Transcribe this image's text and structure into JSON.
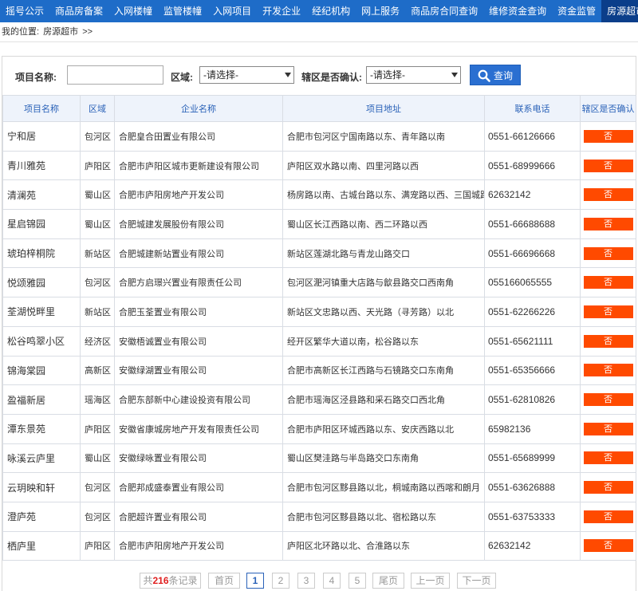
{
  "nav": {
    "items": [
      "摇号公示",
      "商品房备案",
      "入网楼幢",
      "监管楼幢",
      "入网项目",
      "开发企业",
      "经纪机构",
      "网上服务",
      "商品房合同查询",
      "维修资金查询",
      "资金监管",
      "房源超市"
    ],
    "active": "房源超市",
    "colors": {
      "bar": "#1e6cc8",
      "active": "#0b3e8a"
    }
  },
  "breadcrumb": {
    "label": "我的位置:",
    "current": "房源超市",
    "arrows": ">>"
  },
  "search": {
    "project_label": "项目名称:",
    "project_value": "",
    "district_label": "区域:",
    "district_value": "-请选择-",
    "confirm_label": "辖区是否确认:",
    "confirm_value": "-请选择-",
    "button_label": "查询",
    "icon": "search-icon"
  },
  "table": {
    "headers": [
      "项目名称",
      "区域",
      "企业名称",
      "项目地址",
      "联系电话",
      "辖区是否确认"
    ],
    "badge_color": "#ff4a00",
    "rows": [
      {
        "name": "宁和居",
        "district": "包河区",
        "company": "合肥皇合田置业有限公司",
        "address": "合肥市包河区宁国南路以东、青年路以南",
        "phone": "0551-66126666",
        "confirmed": "否"
      },
      {
        "name": "青川雅苑",
        "district": "庐阳区",
        "company": "合肥市庐阳区城市更新建设有限公司",
        "address": "庐阳区双水路以南、四里河路以西",
        "phone": "0551-68999666",
        "confirmed": "否"
      },
      {
        "name": "清澜苑",
        "district": "蜀山区",
        "company": "合肥市庐阳房地产开发公司",
        "address": "杨房路以南、古城台路以东、满宠路以西、三国城路以北",
        "phone": "62632142",
        "confirmed": "否"
      },
      {
        "name": "星启锦园",
        "district": "蜀山区",
        "company": "合肥城建发展股份有限公司",
        "address": "蜀山区长江西路以南、西二环路以西",
        "phone": "0551-66688688",
        "confirmed": "否"
      },
      {
        "name": "琥珀梓桐院",
        "district": "新站区",
        "company": "合肥城建新站置业有限公司",
        "address": "新站区莲湖北路与青龙山路交口",
        "phone": "0551-66696668",
        "confirmed": "否"
      },
      {
        "name": "悦颂雅园",
        "district": "包河区",
        "company": "合肥方启璟兴置业有限责任公司",
        "address": "包河区淝河镇重大店路与歙县路交口西南角",
        "phone": "055166065555",
        "confirmed": "否"
      },
      {
        "name": "荃湖悦畔里",
        "district": "新站区",
        "company": "合肥玉荃置业有限公司",
        "address": "新站区文忠路以西、天光路（寻芳路）以北",
        "phone": "0551-62266226",
        "confirmed": "否"
      },
      {
        "name": "松谷鸣翠小区",
        "district": "经济区",
        "company": "安徽梧诚置业有限公司",
        "address": "经开区繁华大道以南，松谷路以东",
        "phone": "0551-65621111",
        "confirmed": "否"
      },
      {
        "name": "锦海棠园",
        "district": "高新区",
        "company": "安徽绿湖置业有限公司",
        "address": "合肥市高新区长江西路与石镜路交口东南角",
        "phone": "0551-65356666",
        "confirmed": "否"
      },
      {
        "name": "盈福新居",
        "district": "瑶海区",
        "company": "合肥东部新中心建设投资有限公司",
        "address": "合肥市瑶海区泾县路和采石路交口西北角",
        "phone": "0551-62810826",
        "confirmed": "否"
      },
      {
        "name": "潭东景苑",
        "district": "庐阳区",
        "company": "安徽省康城房地产开发有限责任公司",
        "address": "合肥市庐阳区环城西路以东、安庆西路以北",
        "phone": "65982136",
        "confirmed": "否"
      },
      {
        "name": "咏溪云庐里",
        "district": "蜀山区",
        "company": "安徽绿咏置业有限公司",
        "address": "蜀山区樊洼路与半岛路交口东南角",
        "phone": "0551-65689999",
        "confirmed": "否"
      },
      {
        "name": "云玥映和轩",
        "district": "包河区",
        "company": "合肥邦成盛泰置业有限公司",
        "address": "合肥市包河区黟县路以北，桐城南路以西喀和朗月",
        "phone": "0551-63626888",
        "confirmed": "否"
      },
      {
        "name": "澄庐苑",
        "district": "包河区",
        "company": "合肥超许置业有限公司",
        "address": "合肥市包河区黟县路以北、宿松路以东",
        "phone": "0551-63753333",
        "confirmed": "否"
      },
      {
        "name": "栖庐里",
        "district": "庐阳区",
        "company": "合肥市庐阳房地产开发公司",
        "address": "庐阳区北环路以北、合淮路以东",
        "phone": "62632142",
        "confirmed": "否"
      }
    ]
  },
  "pager": {
    "total_prefix": "共",
    "total": "216",
    "total_suffix": "条记录",
    "first": "首页",
    "pages": [
      "1",
      "2",
      "3",
      "4",
      "5"
    ],
    "current": "1",
    "last": "尾页",
    "prev": "上一页",
    "next": "下一页"
  }
}
